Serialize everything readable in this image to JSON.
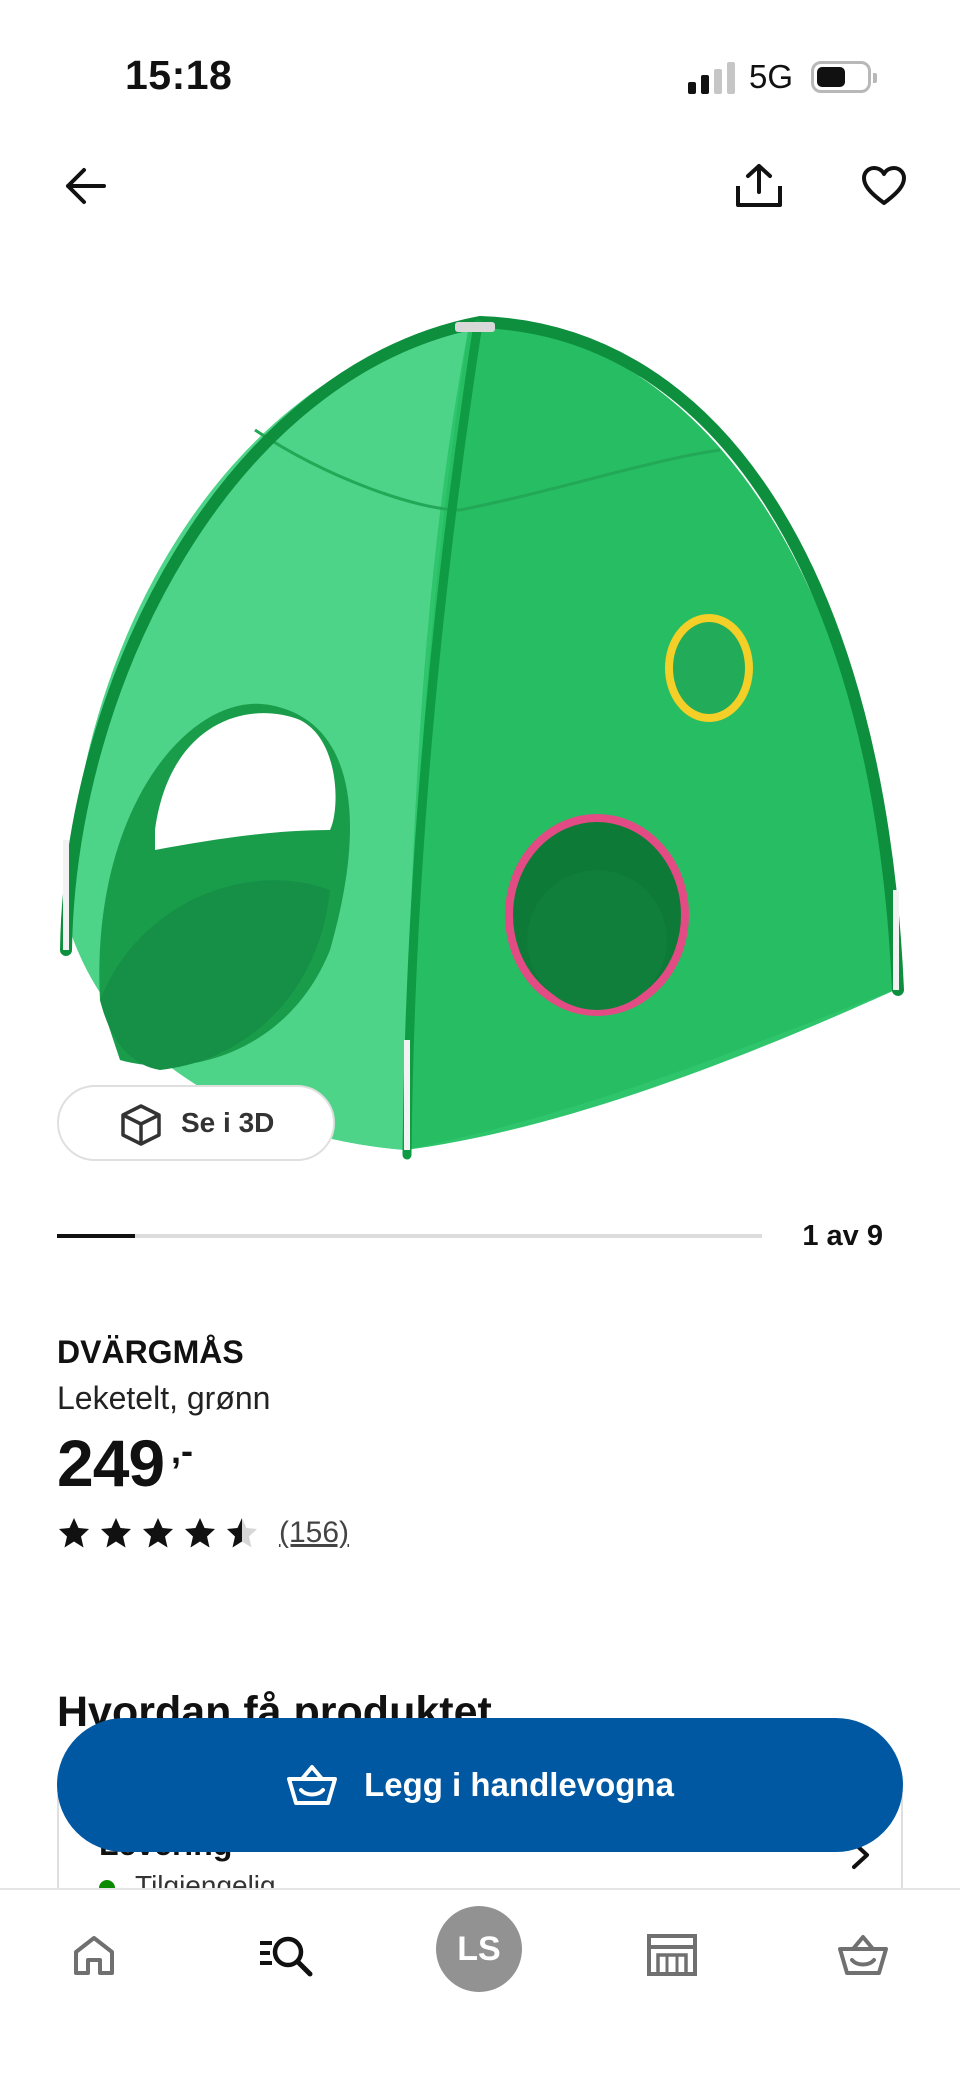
{
  "status_bar": {
    "time": "15:18",
    "network": "5G"
  },
  "header": {
    "back_icon": "arrow-left-icon",
    "share_icon": "share-icon",
    "favorite_icon": "heart-icon"
  },
  "gallery": {
    "see_3d_label": "Se i 3D",
    "counter": "1 av 9",
    "current": 1,
    "total": 9
  },
  "product": {
    "name": "DVÄRGMÅS",
    "description": "Leketelt, grønn",
    "price": "249",
    "price_suffix": ",-",
    "rating": 4.5,
    "rating_max": 5,
    "review_count": "(156)"
  },
  "availability": {
    "heading": "Hvordan få produktet",
    "card_title": "Levering",
    "card_status": "Tilgjengelig"
  },
  "cta": {
    "label": "Legg i handlevogna",
    "color": "#0058a3"
  },
  "nav": {
    "profile_initials": "LS",
    "items": [
      "home-icon",
      "search-icon",
      "profile-avatar",
      "store-icon",
      "cart-icon"
    ]
  }
}
